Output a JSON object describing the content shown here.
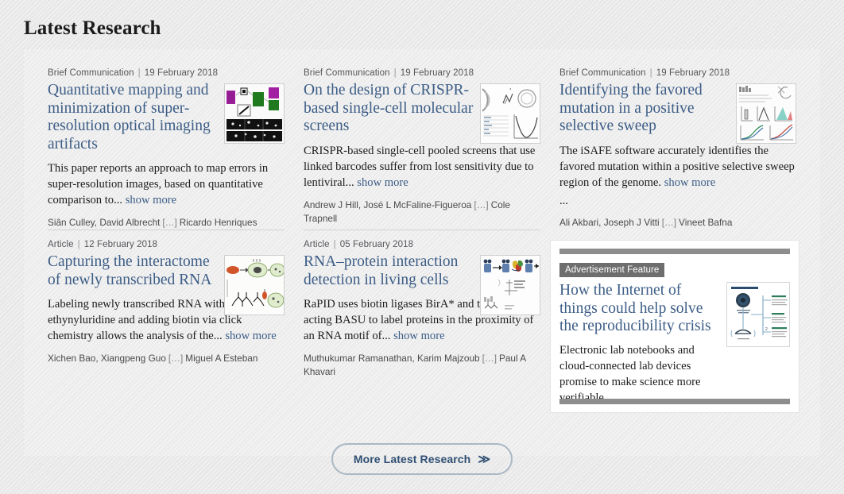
{
  "page_title": "Latest Research",
  "more_button": {
    "label": "More Latest Research",
    "icon": "double-chevron-right-icon",
    "glyph": "≫"
  },
  "separator": "|",
  "etal": "[…]",
  "show_more_label": "show more",
  "colors": {
    "headline_link": "#3c5d86",
    "page_bg": "#e8e8e8",
    "panel_bg": "#ececec",
    "badge_bg": "#6e6e6e",
    "ad_bar": "#8d8d8d",
    "button_border": "#a9b8c4",
    "button_text": "#2f4f73"
  },
  "articles": [
    {
      "type": "Brief Communication",
      "date": "19 February 2018",
      "title": "Quantitative mapping and minimization of super-resolution optical imaging artifacts",
      "summary": "This paper reports an approach to map errors in super-resolution images, based on quantitative comparison to...",
      "authors_lead": "Siân Culley, David Albrecht",
      "authors_last": "Ricardo Henriques",
      "thumb": "microscopy-panels-figure-thumbnail",
      "extra_ellipsis": ""
    },
    {
      "type": "Brief Communication",
      "date": "19 February 2018",
      "title": "On the design of CRISPR-based single-cell molecular screens",
      "summary": "CRISPR-based single-cell pooled screens that use linked barcodes suffer from lost sensitivity due to lentiviral...",
      "authors_lead": "Andrew J Hill, José L McFaline-Figueroa",
      "authors_last": "Cole Trapnell",
      "thumb": "crispr-schematic-plot-thumbnail",
      "extra_ellipsis": ""
    },
    {
      "type": "Brief Communication",
      "date": "19 February 2018",
      "title": "Identifying the favored mutation in a positive selective sweep",
      "summary": "The iSAFE software accurately identifies the favored mutation within a positive selective sweep region of the genome.",
      "authors_lead": "Ali Akbari, Joseph J Vitti",
      "authors_last": "Vineet Bafna",
      "thumb": "genome-sweep-plots-thumbnail",
      "extra_ellipsis": "..."
    },
    {
      "type": "Article",
      "date": "12 February 2018",
      "title": "Capturing the interactome of newly transcribed RNA",
      "summary": "Labeling newly transcribed RNA with 5-ethynyluridine and adding biotin via click chemistry allows the analysis of the...",
      "authors_lead": "Xichen Bao, Xiangpeng Guo",
      "authors_last": "Miguel A Esteban",
      "thumb": "rna-cell-workflow-thumbnail",
      "extra_ellipsis": ""
    },
    {
      "type": "Article",
      "date": "05 February 2018",
      "title": "RNA–protein interaction detection in living cells",
      "summary": "RaPID uses biotin ligases BirA* and the faster acting BASU to label proteins in the proximity of an RNA motif of...",
      "authors_lead": "Muthukumar Ramanathan, Karim Majzoub",
      "authors_last": "Paul A Khavari",
      "thumb": "rna-protein-diagram-thumbnail",
      "extra_ellipsis": ""
    }
  ],
  "advertisement": {
    "badge": "Advertisement Feature",
    "title": "How the Internet of things could help solve the reproducibility crisis",
    "summary": "Electronic lab notebooks and cloud-connected lab devices promise to make science more verifiable.",
    "thumb": "iot-lab-network-diagram-thumbnail"
  }
}
